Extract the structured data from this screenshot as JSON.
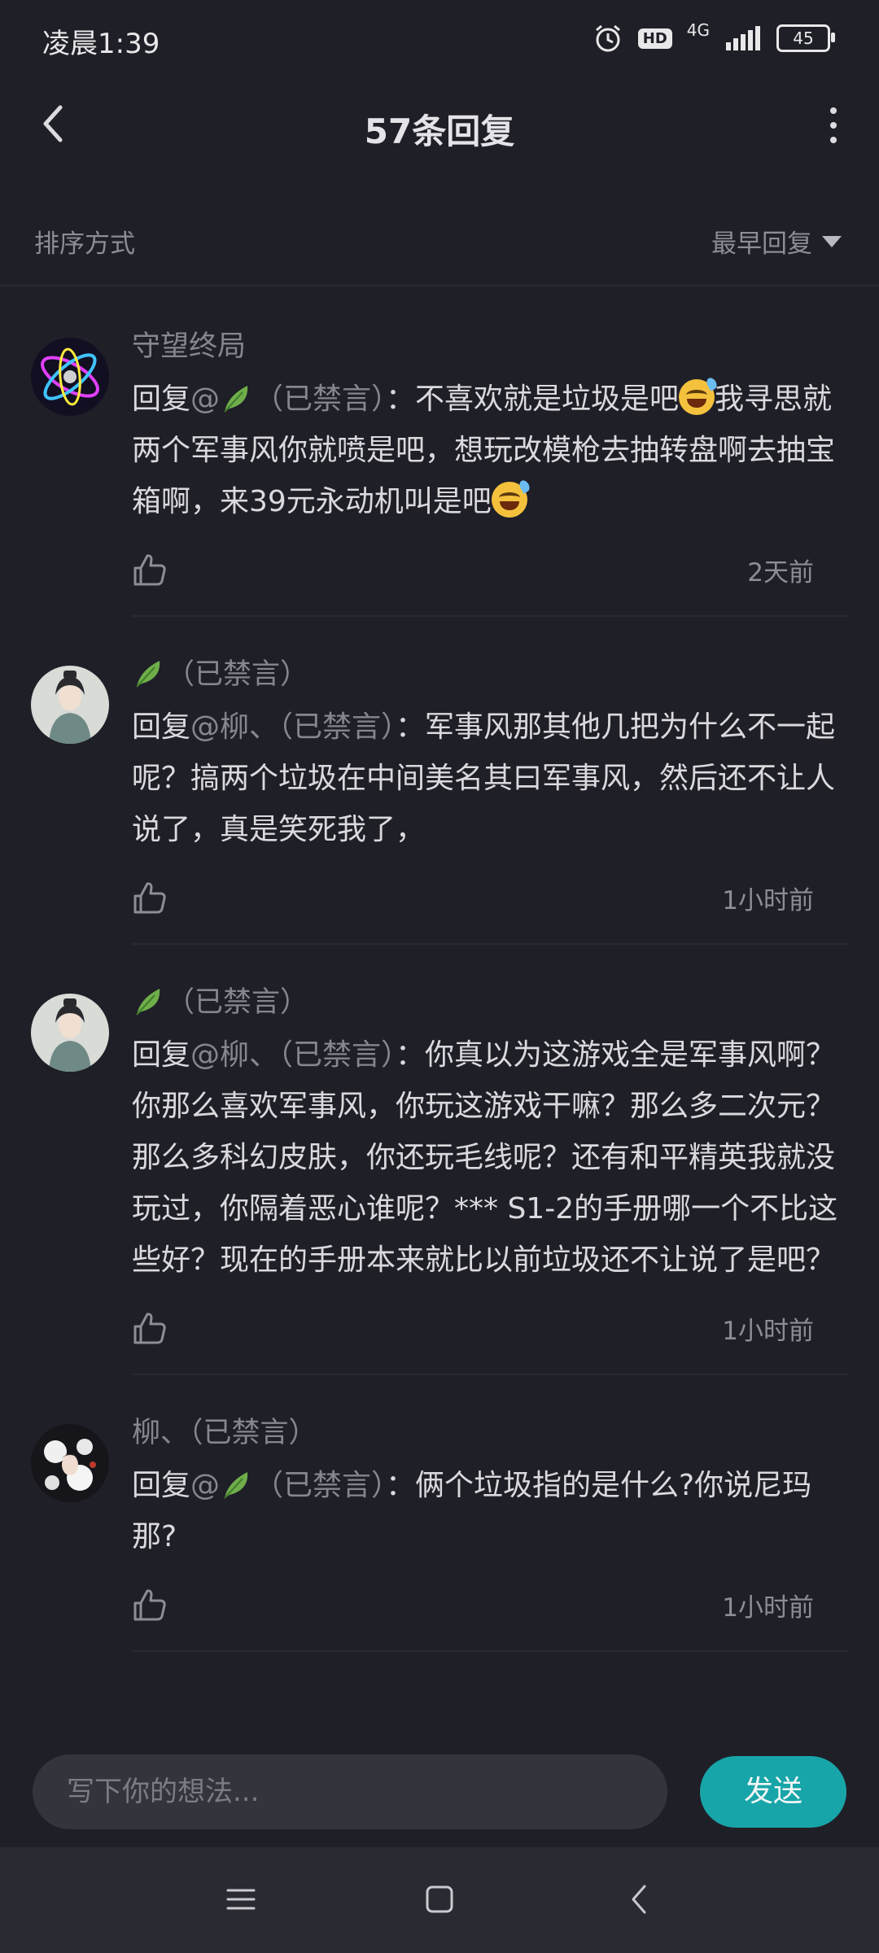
{
  "status_bar": {
    "time": "凌晨1:39",
    "hd": "HD",
    "network": "4G",
    "battery": "45"
  },
  "header": {
    "title": "57条回复"
  },
  "sort": {
    "label": "排序方式",
    "selected": "最早回复"
  },
  "comments": [
    {
      "username": "守望终局",
      "reply_prefix": "回复",
      "mention": "@",
      "mention_suffix": "（已禁言）",
      "text_1": "：不喜欢就是垃圾是吧",
      "text_2": "我寻思就两个军事风你就喷是吧，想玩改模枪去抽转盘啊去抽宝箱啊，来39元永动机叫是吧",
      "time": "2天前"
    },
    {
      "username": "（已禁言）",
      "reply_prefix": "回复",
      "mention": "@柳、（已禁言）",
      "text": "：军事风那其他几把为什么不一起呢？搞两个垃圾在中间美名其曰军事风，然后还不让人说了，真是笑死我了，",
      "time": "1小时前"
    },
    {
      "username": "（已禁言）",
      "reply_prefix": "回复",
      "mention": "@柳、（已禁言）",
      "text": "：你真以为这游戏全是军事风啊？你那么喜欢军事风，你玩这游戏干嘛？那么多二次元？那么多科幻皮肤，你还玩毛线呢？还有和平精英我就没玩过，你隔着恶心谁呢？***  S1-2的手册哪一个不比这些好？现在的手册本来就比以前垃圾还不让说了是吧？",
      "time": "1小时前"
    },
    {
      "username": "柳、（已禁言）",
      "reply_prefix": "回复",
      "mention": "@",
      "mention_suffix": "（已禁言）",
      "text": "：俩个垃圾指的是什么?你说尼玛那?",
      "time": "1小时前"
    }
  ],
  "input": {
    "placeholder": "写下你的想法...",
    "send": "发送"
  },
  "colors": {
    "accent": "#18a5a9",
    "background": "#1f1f27",
    "muted_text": "#86868f"
  }
}
